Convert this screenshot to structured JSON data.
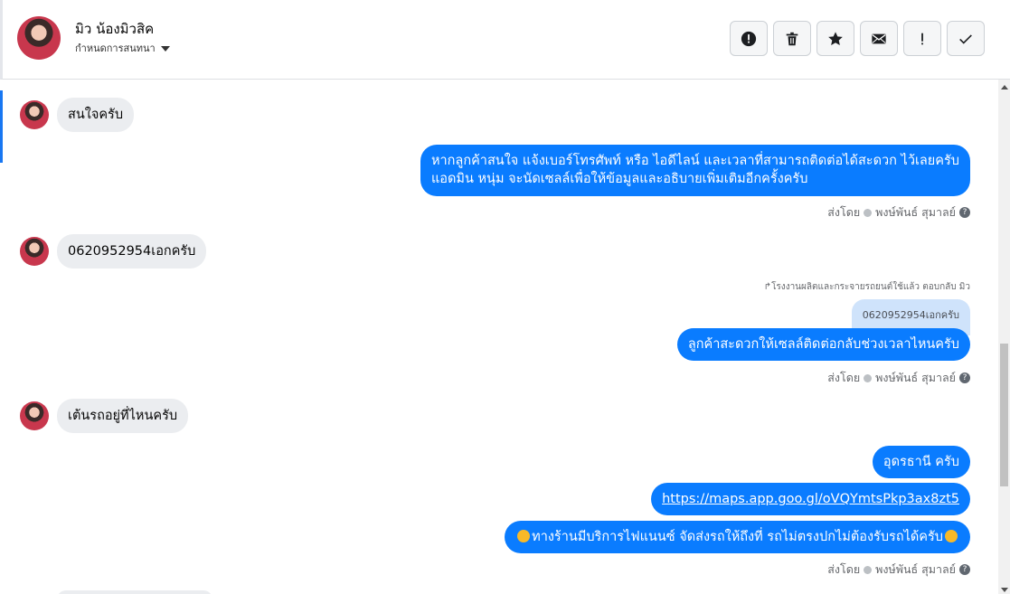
{
  "header": {
    "contact_name": "มิว น้องมิวสิค",
    "subtitle": "กำหนดการสนทนา",
    "actions": [
      {
        "icon": "alert-circle-icon",
        "name": "mark-spam-button"
      },
      {
        "icon": "trash-icon",
        "name": "delete-button"
      },
      {
        "icon": "star-icon",
        "name": "star-button"
      },
      {
        "icon": "envelope-icon",
        "name": "mark-unread-button"
      },
      {
        "icon": "exclamation-icon",
        "name": "follow-up-button"
      },
      {
        "icon": "check-icon",
        "name": "mark-done-button"
      }
    ]
  },
  "messages": {
    "in1": "สนใจครับ",
    "out1_line1": "หากลูกค้าสนใจ แจ้งเบอร์โทรศัพท์ หรือ ไอดีไลน์ และเวลาที่สามารถติดต่อได้สะดวก ไว้เลยครับ",
    "out1_line2": "แอดมิน หนุ่ม จะนัดเซลล์เพื่อให้ข้อมูลและอธิบายเพิ่มเติมอีกครั้งครับ",
    "in2": "0620952954เอกครับ",
    "reply_note": "โรงงานผลิตและกระจายรถยนต์ใช้แล้ว ตอบกลับ มิว",
    "quoted": "0620952954เอกครับ",
    "out2": "ลูกค้าสะดวกให้เซลล์ติดต่อกลับช่วงเวลาไหนครับ",
    "in3": "เต้นรถอยู่ที่ไหนครับ",
    "out3a": "อุดรธานี ครับ",
    "out3b": "https://maps.app.goo.gl/oVQYmtsPkp3ax8zt5",
    "out3c": "ทางร้านมีบริการไฟแนนซ์ จัดส่งรถให้ถึงที่ รถไม่ตรงปกไม่ต้องรับรถได้ครับ"
  },
  "sent_by": {
    "prefix": "ส่งโดย",
    "agent": "พงษ์พันธ์ สุมาลย์"
  },
  "colors": {
    "outgoing_bubble": "#0a7cff",
    "incoming_bubble": "#ebedf0",
    "accent": "#1877f2"
  }
}
